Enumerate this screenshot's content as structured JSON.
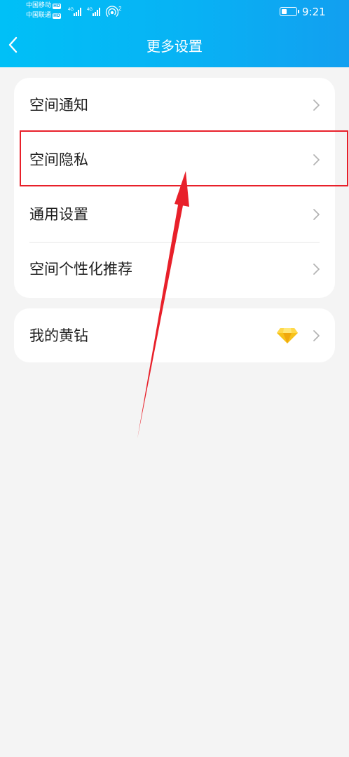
{
  "status_bar": {
    "carrier1": "中国移动",
    "carrier2": "中国联通",
    "hd": "HD",
    "network1": "4G",
    "network2": "4G",
    "hotspot_count": "2",
    "battery_percent": 40,
    "time": "9:21"
  },
  "header": {
    "title": "更多设置",
    "back_icon": "chevron-left-icon"
  },
  "settings_group1": [
    {
      "label": "空间通知"
    },
    {
      "label": "空间隐私"
    },
    {
      "label": "通用设置"
    },
    {
      "label": "空间个性化推荐"
    }
  ],
  "settings_group2": [
    {
      "label": "我的黄钻",
      "icon": "yellow-diamond-icon"
    }
  ],
  "colors": {
    "header_start": "#00c0f7",
    "header_end": "#129ff0",
    "annotation_red": "#e8202a",
    "background": "#f4f4f4"
  }
}
